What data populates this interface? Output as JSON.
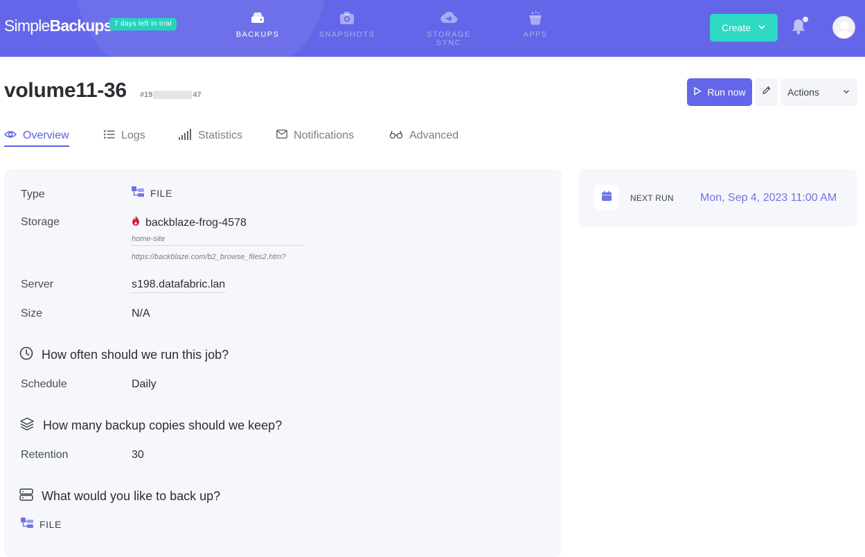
{
  "app": {
    "brand_light": "Simple",
    "brand_bold": "Backups",
    "trial_badge": "7 days left in trial"
  },
  "nav": {
    "items": [
      {
        "label": "BACKUPS",
        "icon": "hard-drive-icon",
        "active": true
      },
      {
        "label": "SNAPSHOTS",
        "icon": "camera-icon",
        "active": false
      },
      {
        "label": "STORAGE SYNC",
        "icon": "cloud-sync-icon",
        "active": false
      },
      {
        "label": "APPS",
        "icon": "apps-pot-icon",
        "active": false
      }
    ],
    "create_label": "Create"
  },
  "header": {
    "title": "volume11-36",
    "id_prefix": "#19",
    "id_suffix": "47",
    "run_label": "Run now",
    "actions_label": "Actions"
  },
  "tabs": [
    {
      "label": "Overview",
      "icon": "eye-icon",
      "active": true
    },
    {
      "label": "Logs",
      "icon": "list-icon",
      "active": false
    },
    {
      "label": "Statistics",
      "icon": "signal-bars-icon",
      "active": false
    },
    {
      "label": "Notifications",
      "icon": "envelope-icon",
      "active": false
    },
    {
      "label": "Advanced",
      "icon": "glasses-icon",
      "active": false
    }
  ],
  "details": {
    "type_label": "Type",
    "type_value": "FILE",
    "storage_label": "Storage",
    "storage_value": "backblaze-frog-4578",
    "storage_bucket": "home-site",
    "storage_url": "https://backblaze.com/b2_browse_files2.htm?",
    "server_label": "Server",
    "server_value": "s198.datafabric.lan",
    "size_label": "Size",
    "size_value": "N/A"
  },
  "schedule_section": {
    "heading": "How often should we run this job?",
    "label": "Schedule",
    "value": "Daily"
  },
  "retention_section": {
    "heading": "How many backup copies should we keep?",
    "label": "Retention",
    "value": "30"
  },
  "backup_section": {
    "heading": "What would you like to back up?",
    "value": "FILE"
  },
  "next_run": {
    "label": "NEXT RUN",
    "value": "Mon, Sep 4, 2023 11:00 AM"
  },
  "colors": {
    "primary": "#6366e8",
    "teal": "#2ed8c3",
    "card_bg": "#f5f7fa",
    "backblaze_red": "#d0203a"
  }
}
